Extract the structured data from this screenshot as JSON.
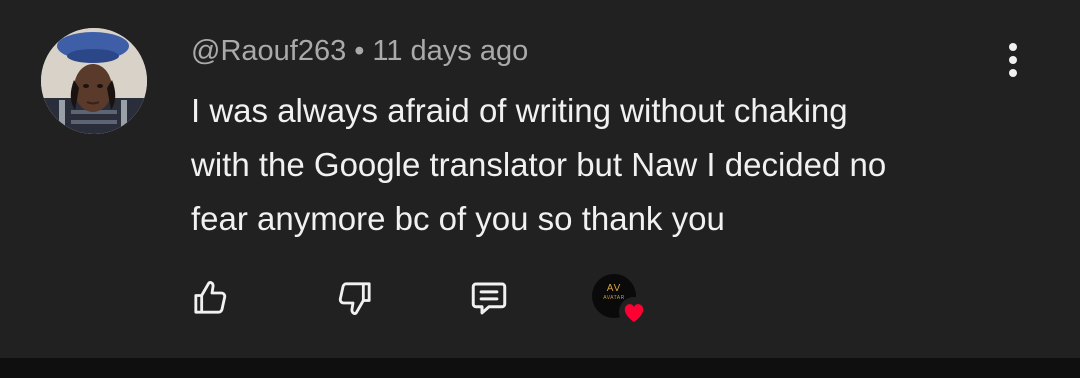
{
  "comment": {
    "author": "@Raouf263",
    "separator": "•",
    "timestamp": "11 days ago",
    "text_lines": [
      "I was always afraid of writing without chaking",
      "with the Google translator but Naw I decided no",
      "fear anymore bc of you so thank you"
    ]
  },
  "creator_badge": {
    "logo_text": "AV",
    "logo_subtext": "AVATAR"
  },
  "icons": {
    "menu": "more-vert-icon",
    "like": "thumbs-up-icon",
    "dislike": "thumbs-down-icon",
    "reply": "comment-reply-icon",
    "heart": "heart-icon"
  },
  "colors": {
    "background": "#212121",
    "text_primary": "#f1f1f1",
    "text_secondary": "#aaaaaa",
    "heart": "#ff0033",
    "creator_logo": "#d9a441"
  }
}
